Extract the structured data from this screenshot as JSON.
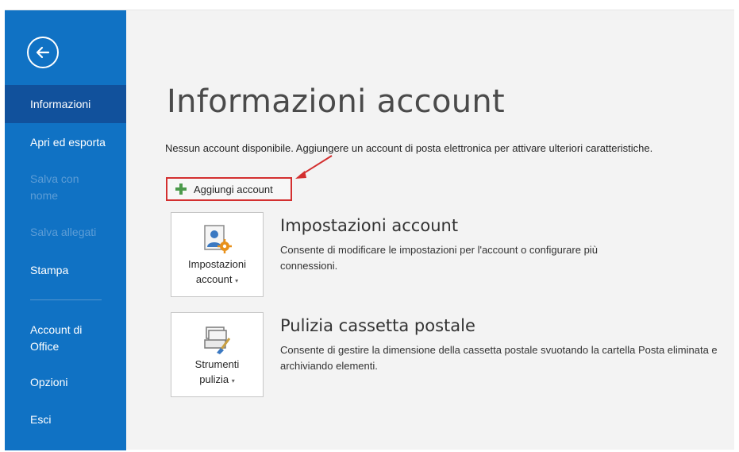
{
  "sidebar": {
    "items": [
      {
        "label": "Informazioni",
        "state": "active"
      },
      {
        "label": "Apri ed esporta",
        "state": "normal"
      },
      {
        "label": "Salva con nome",
        "state": "disabled"
      },
      {
        "label": "Salva allegati",
        "state": "disabled"
      },
      {
        "label": "Stampa",
        "state": "normal"
      },
      {
        "label": "Account di Office",
        "state": "normal"
      },
      {
        "label": "Opzioni",
        "state": "normal"
      },
      {
        "label": "Esci",
        "state": "normal"
      }
    ]
  },
  "main": {
    "title": "Informazioni account",
    "notice": "Nessun account disponibile. Aggiungere un account di posta elettronica per attivare ulteriori caratteristiche.",
    "add_account_label": "Aggiungi account",
    "sections": [
      {
        "tile_label_line1": "Impostazioni",
        "tile_label_line2": "account",
        "title": "Impostazioni account",
        "description": "Consente di modificare le impostazioni per l'account o configurare più connessioni."
      },
      {
        "tile_label_line1": "Strumenti",
        "tile_label_line2": "pulizia",
        "title": "Pulizia cassetta postale",
        "description": "Consente di gestire la dimensione della cassetta postale svuotando la cartella Posta eliminata e archiviando elementi."
      }
    ]
  },
  "colors": {
    "sidebar": "#1072c4",
    "sidebar_active": "#11519c",
    "highlight": "#d32f2f",
    "plus": "#4c9a4c"
  },
  "icons": [
    "back-arrow-icon",
    "plus-icon",
    "account-settings-icon",
    "cleanup-tools-icon",
    "caret-down-icon"
  ]
}
